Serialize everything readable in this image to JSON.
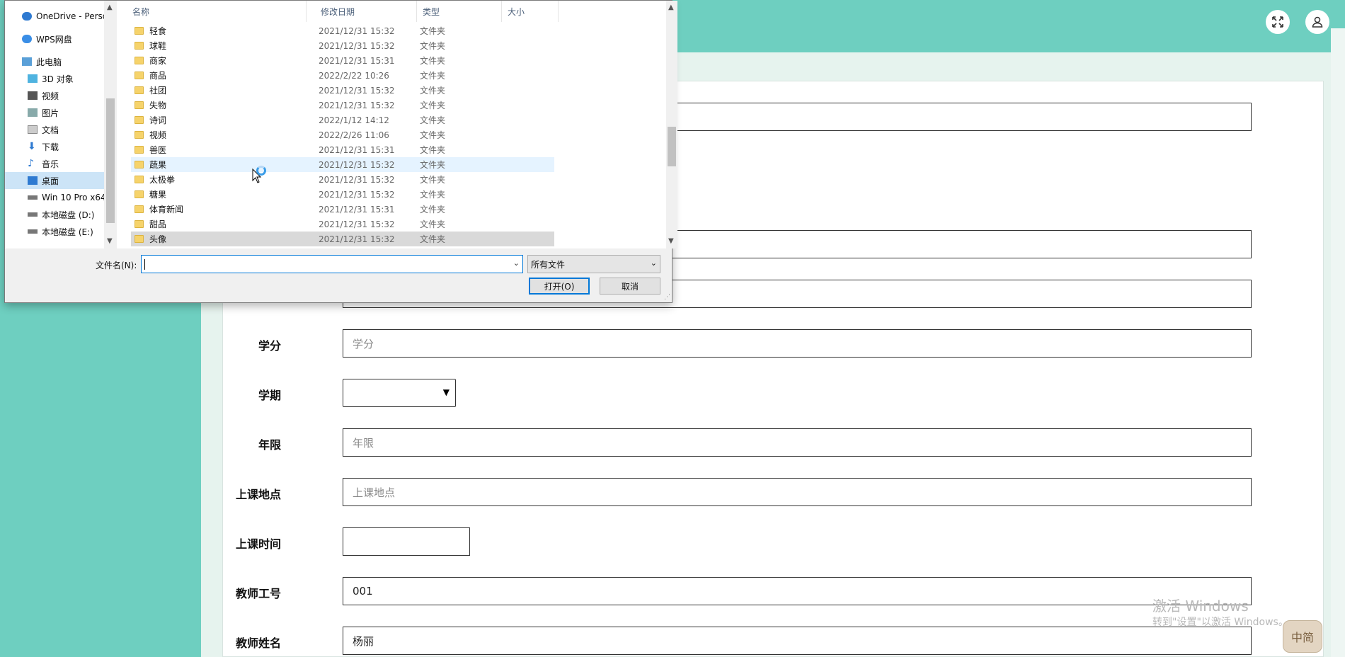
{
  "app": {
    "topbar": {
      "expand_icon": "expand-icon",
      "user_icon": "user-icon"
    },
    "form": {
      "fields": [
        {
          "label": "学分",
          "placeholder": "学分",
          "value": ""
        },
        {
          "label": "学期",
          "type": "select",
          "value": ""
        },
        {
          "label": "年限",
          "placeholder": "年限",
          "value": ""
        },
        {
          "label": "上课地点",
          "placeholder": "上课地点",
          "value": ""
        },
        {
          "label": "上课时间",
          "value": ""
        },
        {
          "label": "教师工号",
          "value": "001"
        },
        {
          "label": "教师姓名",
          "value": "杨丽"
        }
      ]
    },
    "watermark": {
      "line1": "激活 Windows",
      "line2": "转到\"设置\"以激活 Windows。"
    },
    "ime": "中简"
  },
  "dialog": {
    "nav": [
      {
        "label": "OneDrive - Perso",
        "icon": "cloud-icon"
      },
      {
        "label": "WPS网盘",
        "icon": "cloud-icon"
      },
      {
        "label": "此电脑",
        "icon": "computer-icon"
      },
      {
        "label": "3D 对象",
        "icon": "cube-icon"
      },
      {
        "label": "视频",
        "icon": "video-icon"
      },
      {
        "label": "图片",
        "icon": "picture-icon"
      },
      {
        "label": "文档",
        "icon": "document-icon"
      },
      {
        "label": "下载",
        "icon": "download-icon"
      },
      {
        "label": "音乐",
        "icon": "music-icon"
      },
      {
        "label": "桌面",
        "icon": "desktop-icon",
        "selected": true
      },
      {
        "label": "Win 10 Pro x64",
        "icon": "drive-icon"
      },
      {
        "label": "本地磁盘 (D:)",
        "icon": "drive-icon"
      },
      {
        "label": "本地磁盘 (E:)",
        "icon": "drive-icon"
      }
    ],
    "columns": {
      "name": "名称",
      "date": "修改日期",
      "type": "类型",
      "size": "大小"
    },
    "files": [
      {
        "name": "轻食",
        "date": "2021/12/31 15:32",
        "type": "文件夹"
      },
      {
        "name": "球鞋",
        "date": "2021/12/31 15:32",
        "type": "文件夹"
      },
      {
        "name": "商家",
        "date": "2021/12/31 15:31",
        "type": "文件夹"
      },
      {
        "name": "商品",
        "date": "2022/2/22 10:26",
        "type": "文件夹"
      },
      {
        "name": "社团",
        "date": "2021/12/31 15:32",
        "type": "文件夹"
      },
      {
        "name": "失物",
        "date": "2021/12/31 15:32",
        "type": "文件夹"
      },
      {
        "name": "诗词",
        "date": "2022/1/12 14:12",
        "type": "文件夹"
      },
      {
        "name": "视频",
        "date": "2022/2/26 11:06",
        "type": "文件夹"
      },
      {
        "name": "兽医",
        "date": "2021/12/31 15:31",
        "type": "文件夹"
      },
      {
        "name": "蔬果",
        "date": "2021/12/31 15:32",
        "type": "文件夹",
        "state": "hover"
      },
      {
        "name": "太极拳",
        "date": "2021/12/31 15:32",
        "type": "文件夹"
      },
      {
        "name": "糖果",
        "date": "2021/12/31 15:32",
        "type": "文件夹"
      },
      {
        "name": "体育新闻",
        "date": "2021/12/31 15:31",
        "type": "文件夹"
      },
      {
        "name": "甜品",
        "date": "2021/12/31 15:32",
        "type": "文件夹"
      },
      {
        "name": "头像",
        "date": "2021/12/31 15:32",
        "type": "文件夹",
        "state": "selected"
      }
    ],
    "filename_label": "文件名(N):",
    "filename_value": "",
    "filter_value": "所有文件",
    "open_button": "打开(O)",
    "cancel_button": "取消"
  }
}
